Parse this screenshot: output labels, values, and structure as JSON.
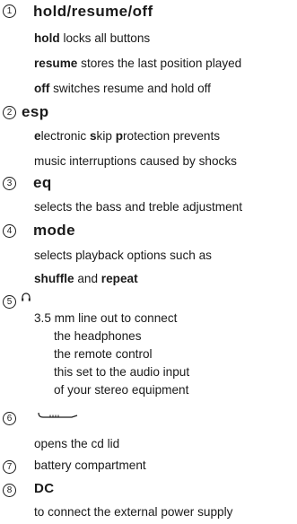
{
  "items": [
    {
      "num": "1",
      "title": "hold/resume/off"
    },
    {
      "num": "2",
      "title": "esp"
    },
    {
      "num": "3",
      "title": "eq"
    },
    {
      "num": "4",
      "title": "mode"
    },
    {
      "num": "5",
      "title": "",
      "icon": "headphones-icon"
    },
    {
      "num": "6",
      "title": "",
      "icon": "cd-lid-slider-icon"
    },
    {
      "num": "7",
      "title": ""
    },
    {
      "num": "8",
      "title": "DC"
    }
  ],
  "text": {
    "hold_key": "hold",
    "hold_rest": " locks all buttons",
    "resume_key": "resume",
    "resume_rest": " stores the last position played",
    "off_key": "off",
    "off_rest": " switches resume and hold off",
    "esp_e": "e",
    "esp_1": "lectronic ",
    "esp_s": "s",
    "esp_2": "kip ",
    "esp_p": "p",
    "esp_3": "rotection prevents",
    "esp_line2": "music interruptions caused by shocks",
    "eq_desc": "selects the bass and treble adjustment",
    "mode_line1": "selects playback options such as",
    "shuffle": "shuffle",
    "and": " and ",
    "repeat": "repeat",
    "lineout": "3.5 mm line out to connect",
    "headphones": "the headphones",
    "remote": "the remote control",
    "audio_in": "this set to the audio input",
    "stereo": "of your stereo equipment",
    "opens": "opens the cd lid",
    "battery": "battery compartment",
    "dc_desc": "to connect the external power supply"
  }
}
